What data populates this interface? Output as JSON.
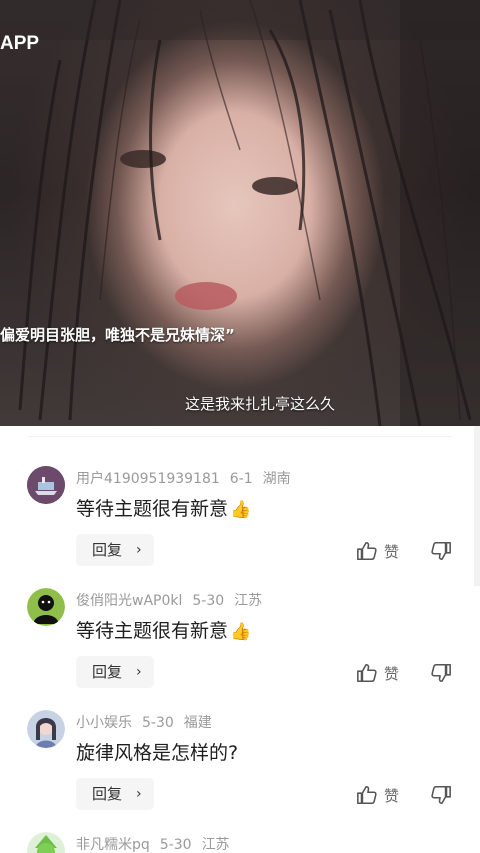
{
  "video": {
    "brand_fragment": "APP",
    "title_caption": "偏爱明目张胆，唯独不是兄妹情深”",
    "subtitle": "这是我来扎扎亭这么久"
  },
  "comments": [
    {
      "username": "用户4190951939181",
      "date": "6-1",
      "location": "湖南",
      "text": "等待主题很有新意",
      "emoji": "👍",
      "reply_label": "回复",
      "like_label": "赞",
      "avatar": "ship-avatar"
    },
    {
      "username": "俊俏阳光wAP0kl",
      "date": "5-30",
      "location": "江苏",
      "text": "等待主题很有新意",
      "emoji": "👍",
      "reply_label": "回复",
      "like_label": "赞",
      "avatar": "black-figure-avatar"
    },
    {
      "username": "小小娱乐",
      "date": "5-30",
      "location": "福建",
      "text": "旋律风格是怎样的?",
      "emoji": "",
      "reply_label": "回复",
      "like_label": "赞",
      "avatar": "girl-avatar"
    },
    {
      "username": "非凡糯米pq",
      "date": "5-30",
      "location": "江苏",
      "avatar": "green-character-avatar"
    }
  ],
  "icons": {
    "reply_chevron": "›",
    "like": "thumb-up-icon",
    "dislike": "thumb-down-icon"
  },
  "colors": {
    "meta_text": "#9a9a9a",
    "content_text": "#1f1f1f",
    "reply_bg": "#f5f5f5"
  }
}
